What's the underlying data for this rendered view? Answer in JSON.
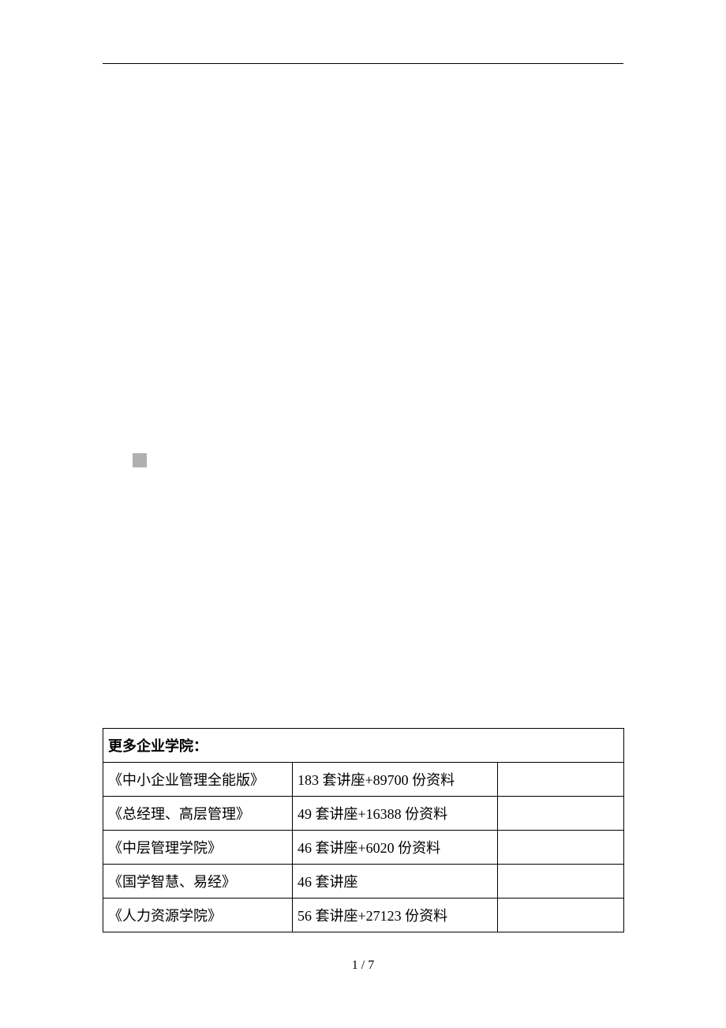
{
  "table": {
    "header": "更多企业学院：",
    "rows": [
      {
        "name": "《中小企业管理全能版》",
        "detail": "183 套讲座+89700 份资料",
        "extra": ""
      },
      {
        "name": "《总经理、高层管理》",
        "detail": "49 套讲座+16388 份资料",
        "extra": ""
      },
      {
        "name": "《中层管理学院》",
        "detail": "46 套讲座+6020 份资料",
        "extra": ""
      },
      {
        "name": "《国学智慧、易经》",
        "detail": "46 套讲座",
        "extra": ""
      },
      {
        "name": "《人力资源学院》",
        "detail": "56 套讲座+27123 份资料",
        "extra": ""
      }
    ]
  },
  "footer": "1 / 7"
}
